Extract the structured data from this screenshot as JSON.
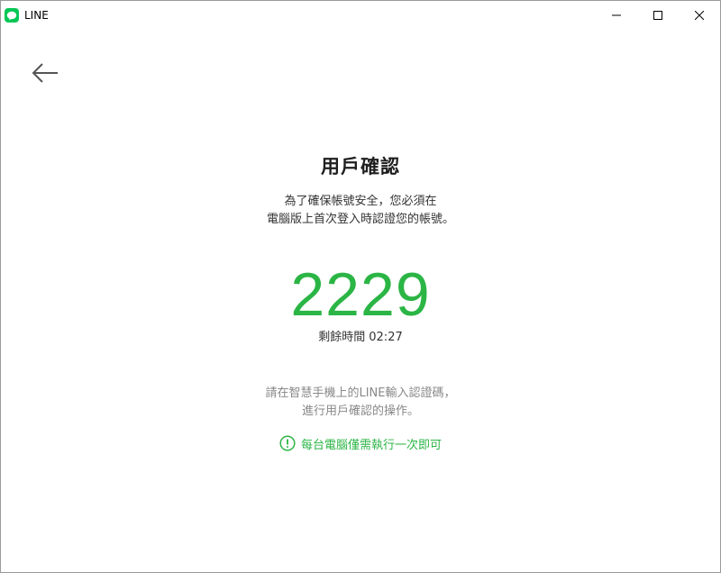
{
  "window": {
    "title": "LINE",
    "app_icon": "line-app-icon",
    "controls": [
      "minimize-icon",
      "maximize-icon",
      "close-icon"
    ]
  },
  "nav": {
    "back_icon": "arrow-left-icon"
  },
  "main": {
    "title": "用戶確認",
    "description_line1": "為了確保帳號安全，您必須在",
    "description_line2": "電腦版上首次登入時認證您的帳號。",
    "code": "2229",
    "timer_label": "剩餘時間",
    "timer_value": "02:27",
    "instruction_line1": "請在智慧手機上的LINE輸入認證碼，",
    "instruction_line2": "進行用戶確認的操作。",
    "notice_icon": "exclamation-circle-icon",
    "notice_text": "每台電腦僅需執行一次即可"
  },
  "colors": {
    "brand_green": "#06c755",
    "code_green": "#2bb545",
    "text_dark": "#1e1e1e",
    "text_gray": "#888888"
  }
}
